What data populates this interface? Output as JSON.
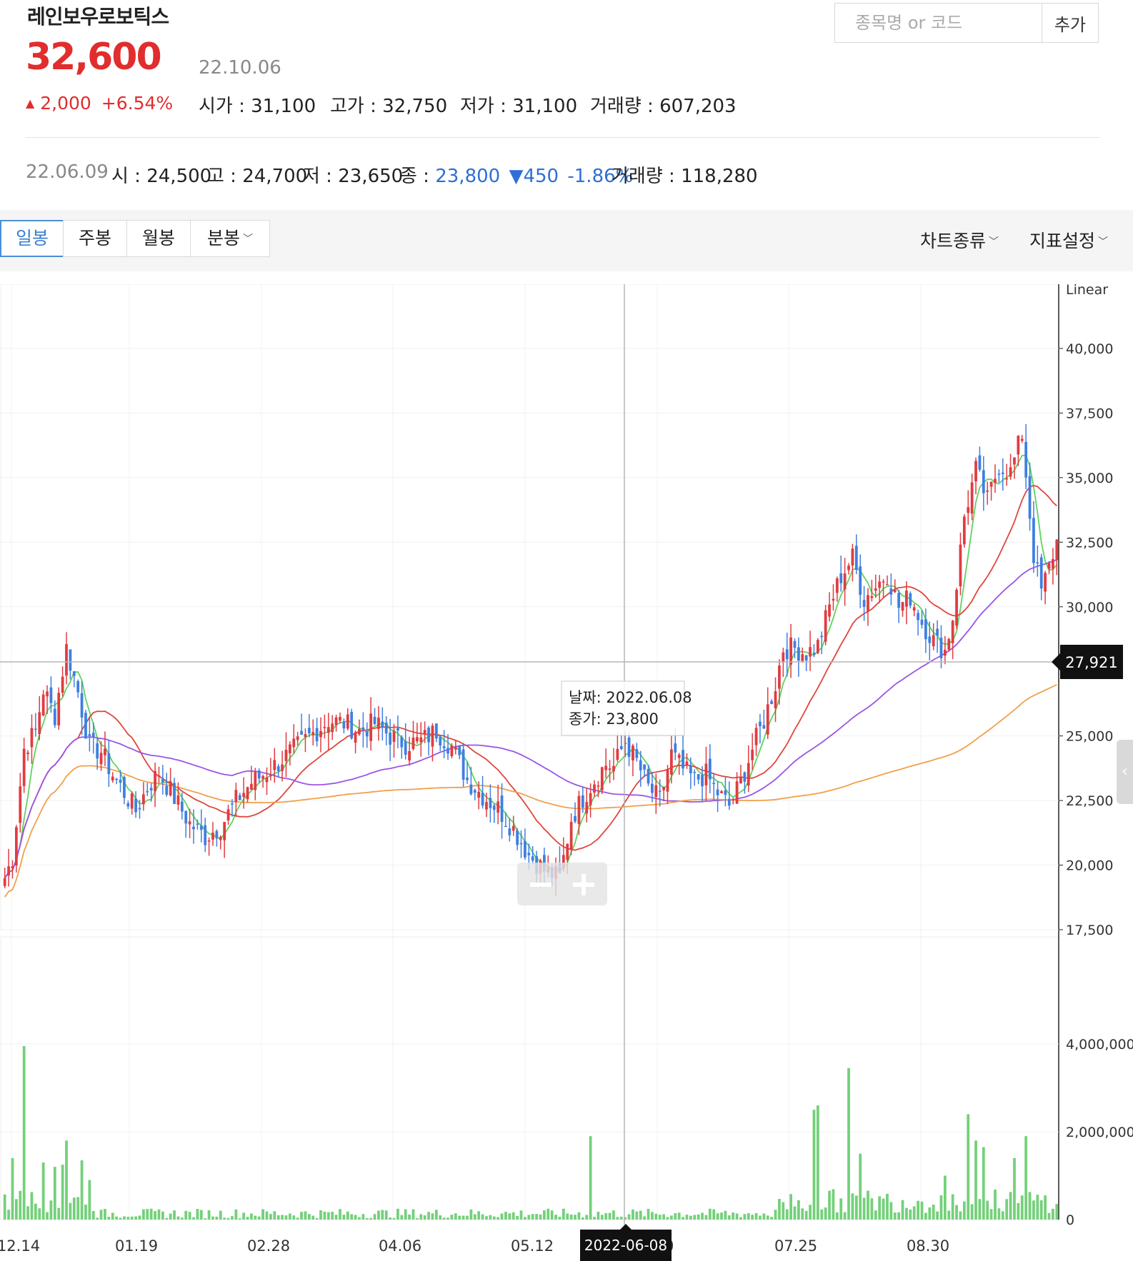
{
  "header": {
    "stock_name": "레인보우로보틱스",
    "price": "32,600",
    "date": "22.10.06",
    "change_symbol": "▲",
    "change": "2,000",
    "change_pct": "+6.54%",
    "stats": [
      {
        "label": "시가",
        "value": "31,100"
      },
      {
        "label": "고가",
        "value": "32,750"
      },
      {
        "label": "저가",
        "value": "31,100"
      },
      {
        "label": "거래량",
        "value": "607,203"
      }
    ]
  },
  "search": {
    "placeholder": "종목명 or 코드",
    "add_label": "추가"
  },
  "selected_day": {
    "date": "22.06.09",
    "open_label": "시",
    "open": "24,500",
    "high_label": "고",
    "high": "24,700",
    "low_label": "저",
    "low": "23,650",
    "close_label": "종",
    "close": "23,800",
    "change_symbol": "▼",
    "change": "450",
    "change_pct": "-1.86%",
    "volume_label": "거래량",
    "volume": "118,280"
  },
  "toolbar": {
    "tabs": [
      {
        "label": "일봉",
        "active": true
      },
      {
        "label": "주봉",
        "active": false
      },
      {
        "label": "월봉",
        "active": false
      },
      {
        "label": "분봉",
        "active": false
      }
    ],
    "chart_type_label": "차트종류",
    "indicator_label": "지표설정"
  },
  "chart_data": {
    "type": "candlestick",
    "scale_label": "Linear",
    "price_ylim": [
      17500,
      40000
    ],
    "price_ticks": [
      "40,000",
      "37,500",
      "35,000",
      "32,500",
      "30,000",
      "25,000",
      "22,500",
      "20,000",
      "17,500"
    ],
    "volume_ylim": [
      0,
      4000000
    ],
    "volume_ticks": [
      "4,000,000",
      "2,000,000",
      "0"
    ],
    "x_ticks": [
      "12.14",
      "01.19",
      "02.28",
      "04.06",
      "05.12",
      "20",
      "07.25",
      "08.30"
    ],
    "crosshair_price": "27,921",
    "crosshair_date": "2022-06-08",
    "tooltip": {
      "date_label": "날짜",
      "date": "2022.06.08",
      "close_label": "종가",
      "close": "23,800"
    },
    "up_color": "#e03c41",
    "down_color": "#3f7fe0",
    "volume_color": "#74d07a",
    "ma_colors": [
      "#5fd35f",
      "#e0463c",
      "#9a55e8",
      "#f0a04a"
    ],
    "anchors_close": [
      [
        0,
        19500
      ],
      [
        2,
        20300
      ],
      [
        5,
        24500
      ],
      [
        8,
        25200
      ],
      [
        10,
        26800
      ],
      [
        13,
        25800
      ],
      [
        16,
        28400
      ],
      [
        19,
        26700
      ],
      [
        22,
        24600
      ],
      [
        25,
        24400
      ],
      [
        28,
        23500
      ],
      [
        31,
        22800
      ],
      [
        34,
        22100
      ],
      [
        37,
        23000
      ],
      [
        40,
        23600
      ],
      [
        44,
        22600
      ],
      [
        48,
        21600
      ],
      [
        52,
        21100
      ],
      [
        56,
        21500
      ],
      [
        60,
        22500
      ],
      [
        64,
        23200
      ],
      [
        68,
        23600
      ],
      [
        72,
        24100
      ],
      [
        76,
        24600
      ],
      [
        80,
        25100
      ],
      [
        84,
        25600
      ],
      [
        88,
        25500
      ],
      [
        92,
        25200
      ],
      [
        96,
        25500
      ],
      [
        100,
        25000
      ],
      [
        104,
        24700
      ],
      [
        108,
        24800
      ],
      [
        112,
        25200
      ],
      [
        116,
        24600
      ],
      [
        120,
        23300
      ],
      [
        124,
        22700
      ],
      [
        128,
        22200
      ],
      [
        132,
        21400
      ],
      [
        136,
        20400
      ],
      [
        140,
        19800
      ],
      [
        144,
        19500
      ],
      [
        147,
        21800
      ],
      [
        150,
        22600
      ],
      [
        153,
        23300
      ],
      [
        156,
        23900
      ],
      [
        158,
        23800
      ],
      [
        161,
        24800
      ],
      [
        164,
        24000
      ],
      [
        167,
        23000
      ],
      [
        170,
        22500
      ],
      [
        173,
        24300
      ],
      [
        176,
        23700
      ],
      [
        179,
        23300
      ],
      [
        182,
        23500
      ],
      [
        185,
        22800
      ],
      [
        188,
        22300
      ],
      [
        191,
        23200
      ],
      [
        194,
        24500
      ],
      [
        197,
        25600
      ],
      [
        200,
        27000
      ],
      [
        202,
        28400
      ],
      [
        205,
        28400
      ],
      [
        208,
        28200
      ],
      [
        211,
        28500
      ],
      [
        214,
        30000
      ],
      [
        217,
        31200
      ],
      [
        220,
        31900
      ],
      [
        223,
        30300
      ],
      [
        226,
        30800
      ],
      [
        229,
        31300
      ],
      [
        232,
        30000
      ],
      [
        235,
        30400
      ],
      [
        238,
        29400
      ],
      [
        241,
        28700
      ],
      [
        244,
        28300
      ],
      [
        246,
        29600
      ],
      [
        249,
        33500
      ],
      [
        252,
        35300
      ],
      [
        255,
        34100
      ],
      [
        258,
        35500
      ],
      [
        261,
        35200
      ],
      [
        264,
        36700
      ],
      [
        267,
        32000
      ],
      [
        269,
        30600
      ],
      [
        271,
        31500
      ],
      [
        273,
        32600
      ]
    ],
    "n_days": 274,
    "volume_spikes": [
      [
        2,
        1400000
      ],
      [
        5,
        3950000
      ],
      [
        10,
        1300000
      ],
      [
        13,
        1200000
      ],
      [
        15,
        1250000
      ],
      [
        16,
        1800000
      ],
      [
        20,
        1350000
      ],
      [
        22,
        900000
      ],
      [
        152,
        1900000
      ],
      [
        210,
        2500000
      ],
      [
        211,
        2600000
      ],
      [
        219,
        3450000
      ],
      [
        222,
        1500000
      ],
      [
        244,
        1000000
      ],
      [
        250,
        2400000
      ],
      [
        252,
        1800000
      ],
      [
        254,
        1650000
      ],
      [
        262,
        1400000
      ],
      [
        265,
        1900000
      ]
    ]
  }
}
